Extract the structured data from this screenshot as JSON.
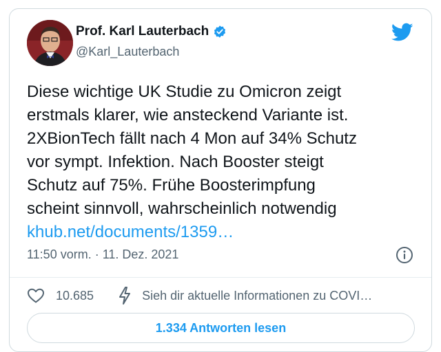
{
  "author": {
    "name": "Prof. Karl Lauterbach",
    "handle": "@Karl_Lauterbach",
    "verified": true
  },
  "tweet": {
    "lines": [
      "Diese wichtige UK Studie zu Omicron zeigt",
      "erstmals klarer, wie ansteckend Variante ist.",
      "2XBionTech fällt nach 4 Mon auf 34% Schutz",
      "vor sympt. Infektion. Nach Booster steigt",
      "Schutz auf 75%. Frühe Boosterimpfung",
      "scheint sinnvoll, wahrscheinlich notwendig"
    ],
    "link": "khub.net/documents/1359…"
  },
  "meta": {
    "timestamp": "11:50 vorm. · 11. Dez. 2021"
  },
  "actions": {
    "like_count": "10.685",
    "covid_info": "Sieh dir aktuelle Informationen zu COVI…"
  },
  "replies_button": "1.334 Antworten lesen",
  "icons": {
    "logo": "twitter-bird-icon",
    "verified": "verified-badge-icon",
    "info": "info-icon",
    "like": "heart-icon",
    "covid": "lightning-icon"
  },
  "colors": {
    "accent": "#1d9bf0",
    "text": "#0f1419",
    "muted": "#536471",
    "border": "#cfd9de"
  }
}
